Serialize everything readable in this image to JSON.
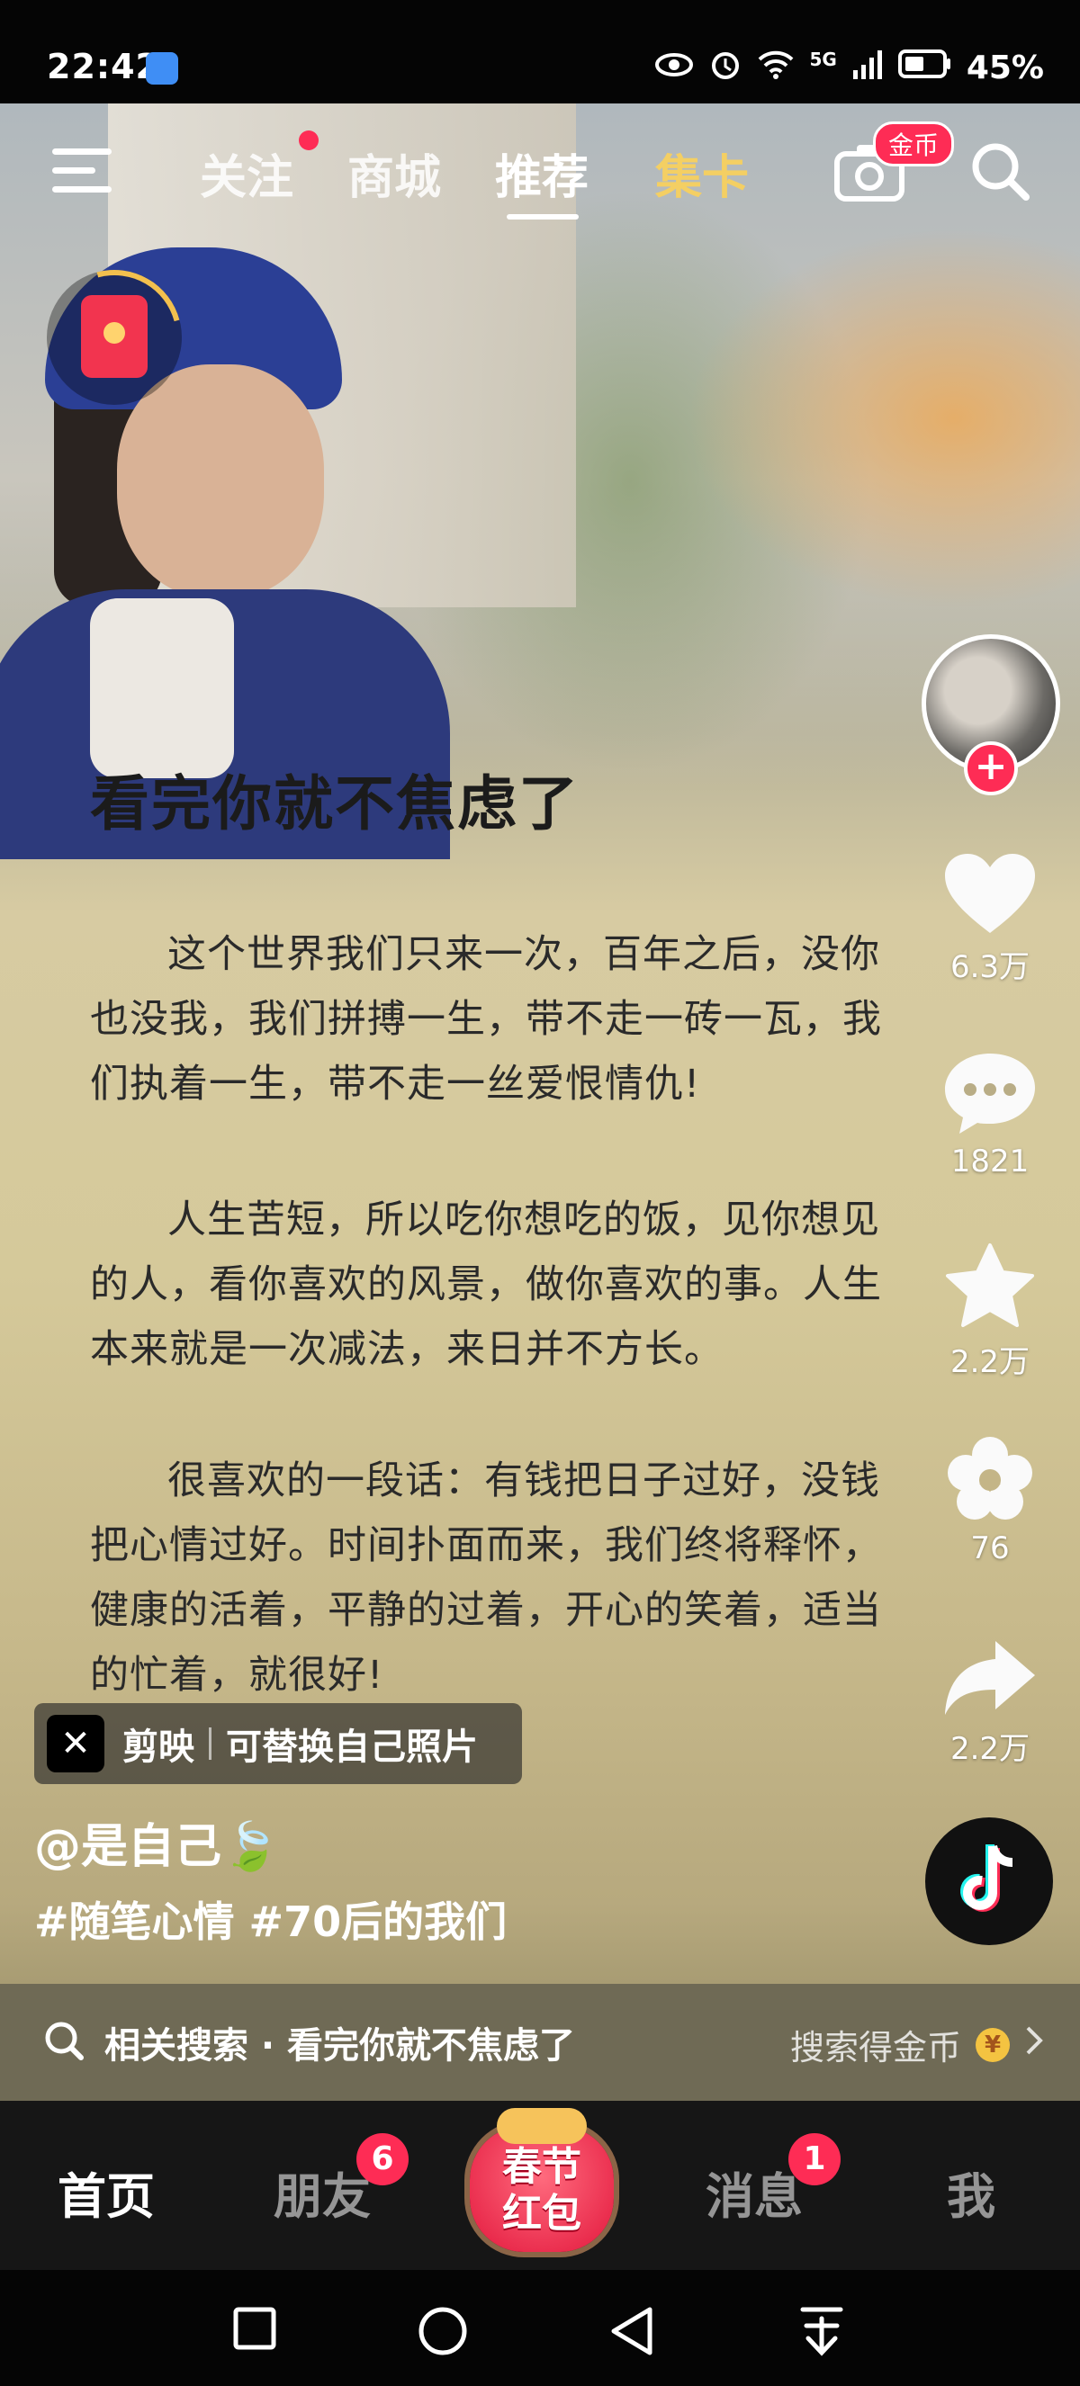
{
  "status_bar": {
    "time": "22:42",
    "network": "5G",
    "battery": "45%",
    "icons": [
      "app-notification-icon",
      "eye-icon",
      "alarm-icon",
      "wifi-icon",
      "signal-icon",
      "battery-icon"
    ]
  },
  "top_nav": {
    "tabs": [
      "关注",
      "商城",
      "推荐",
      "集卡"
    ],
    "active_tab": "推荐",
    "camera_badge": "金币"
  },
  "video": {
    "heading": "看完你就不焦虑了",
    "paragraphs": [
      "这个世界我们只来一次，百年之后，没你也没我，我们拼搏一生，带不走一砖一瓦，我们执着一生，带不走一丝爱恨情仇!",
      "人生苦短，所以吃你想吃的饭，见你想见的人，看你喜欢的风景，做你喜欢的事。人生本来就是一次减法，来日并不方长。",
      "很喜欢的一段话：有钱把日子过好，没钱把心情过好。时间扑面而来，我们终将释怀，健康的活着，平静的过着，开心的笑着，适当的忙着，就很好!"
    ],
    "author": "@是自己🍃",
    "hashtags": "#随笔心情 #70后的我们",
    "capcut": {
      "name": "剪映",
      "desc": "可替换自己照片"
    }
  },
  "rail": {
    "likes": "6.3万",
    "comments": "1821",
    "favorites": "2.2万",
    "flower": "76",
    "shares": "2.2万"
  },
  "related_search": {
    "label": "相关搜索 · 看完你就不焦虑了",
    "action": "搜索得金币"
  },
  "bottom_tabs": {
    "home": "首页",
    "friends": "朋友",
    "friends_badge": "6",
    "center_line1": "春节",
    "center_line2": "红包",
    "messages": "消息",
    "messages_badge": "1",
    "me": "我"
  },
  "colors": {
    "accent_red": "#fe2c55",
    "gold": "#f4cf63",
    "tabbar_bg": "#161616"
  }
}
